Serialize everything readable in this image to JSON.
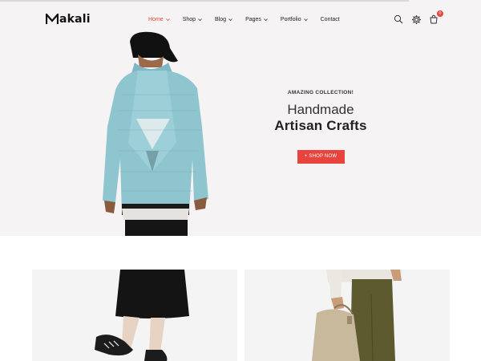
{
  "header": {
    "logo_text": "akali",
    "nav": [
      {
        "label": "Home",
        "has_dropdown": true,
        "active": true
      },
      {
        "label": "Shop",
        "has_dropdown": true,
        "active": false
      },
      {
        "label": "Blog",
        "has_dropdown": true,
        "active": false
      },
      {
        "label": "Pages",
        "has_dropdown": true,
        "active": false
      },
      {
        "label": "Portfolio",
        "has_dropdown": true,
        "active": false
      },
      {
        "label": "Contact",
        "has_dropdown": false,
        "active": false
      }
    ],
    "icons": [
      "search-icon",
      "gear-icon",
      "cart-icon"
    ],
    "cart_count": "0"
  },
  "hero": {
    "eyebrow": "AMAZING COLLECTION!",
    "headline_line1": "Handmade",
    "headline_line2": "Artisan Crafts",
    "cta_label": "+ SHOP NOW"
  },
  "colors": {
    "accent": "#e8443d",
    "hero_background": "#f5f3f3",
    "card_background": "#f4f4f4",
    "jacket": "#8ec5cf"
  }
}
